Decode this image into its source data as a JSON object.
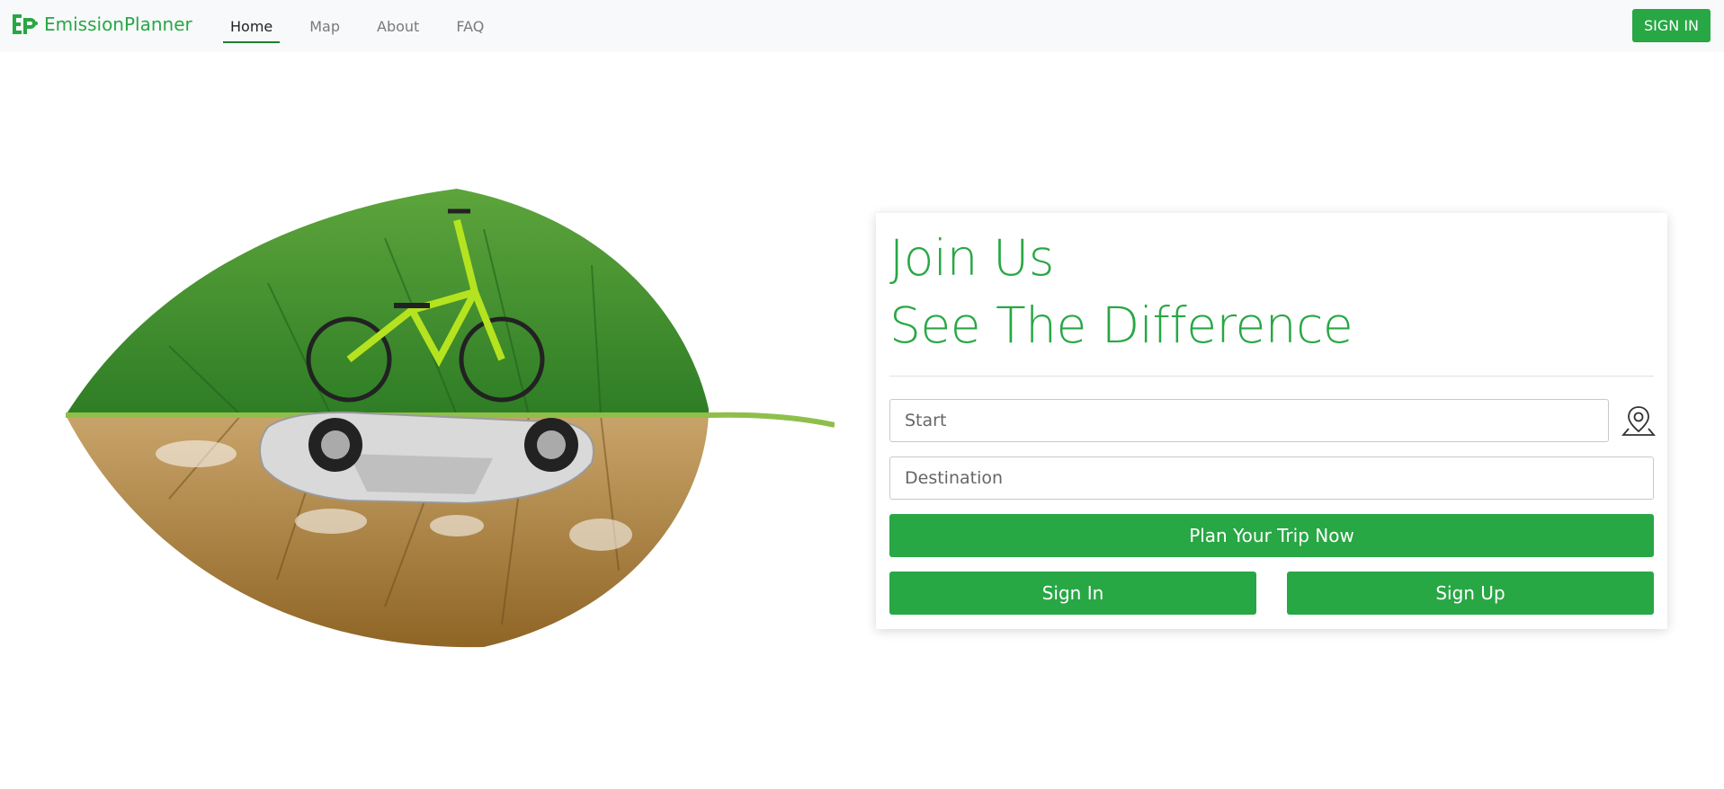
{
  "brand": {
    "name": "EmissionPlanner",
    "icon": "ep-logo-icon",
    "color": "#28a745"
  },
  "nav": {
    "items": [
      {
        "label": "Home",
        "active": true
      },
      {
        "label": "Map",
        "active": false
      },
      {
        "label": "About",
        "active": false
      },
      {
        "label": "FAQ",
        "active": false
      }
    ],
    "signin_label": "SIGN IN"
  },
  "hero": {
    "image": "leaf-bicycle-car-illustration"
  },
  "card": {
    "heading_line1": "Join Us",
    "heading_line2": "See The Difference",
    "start_placeholder": "Start",
    "start_value": "",
    "destination_placeholder": "Destination",
    "destination_value": "",
    "location_icon": "map-pin-icon",
    "plan_label": "Plan Your Trip Now",
    "signin_label": "Sign In",
    "signup_label": "Sign Up"
  },
  "colors": {
    "accent": "#28a745",
    "nav_bg": "#f8f9fa"
  }
}
